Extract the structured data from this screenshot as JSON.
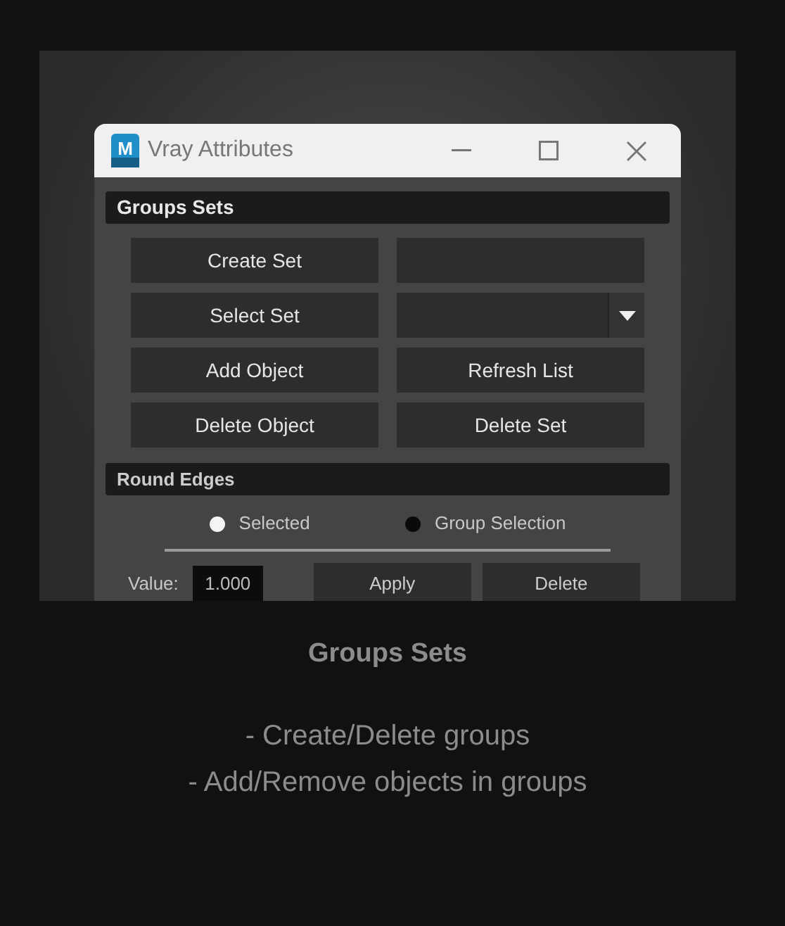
{
  "window": {
    "title": "Vray Attributes",
    "app_icon_letter": "M"
  },
  "groups_sets": {
    "title": "Groups Sets",
    "controls": [
      {
        "kind": "button",
        "label": "Create Set"
      },
      {
        "kind": "field"
      },
      {
        "kind": "button",
        "label": "Select Set"
      },
      {
        "kind": "dropdown"
      },
      {
        "kind": "button",
        "label": "Add Object"
      },
      {
        "kind": "button",
        "label": "Refresh List"
      },
      {
        "kind": "button",
        "label": "Delete Object"
      },
      {
        "kind": "button",
        "label": "Delete Set"
      }
    ]
  },
  "round_edges": {
    "title": "Round Edges",
    "radios": [
      {
        "label": "Selected",
        "selected": true
      },
      {
        "label": "Group Selection",
        "selected": false
      }
    ],
    "value_label": "Value:",
    "value": "1.000",
    "buttons": [
      "Apply",
      "Delete"
    ]
  },
  "caption": {
    "title": "Groups Sets",
    "lines": [
      "- Create/Delete groups",
      "- Add/Remove objects in groups"
    ]
  }
}
